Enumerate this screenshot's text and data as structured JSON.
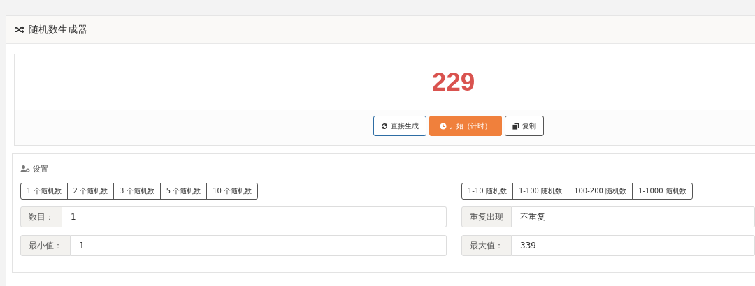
{
  "panel": {
    "title": "随机数生成器"
  },
  "result": {
    "value": "229"
  },
  "actions": [
    {
      "kind": "refresh",
      "label": "直接生成"
    },
    {
      "kind": "clock",
      "label": "开始（计时）",
      "primary": true
    },
    {
      "kind": "copy",
      "label": "复制"
    }
  ],
  "settings": {
    "title": "设置",
    "count_presets": [
      "1 个随机数",
      "2 个随机数",
      "3 个随机数",
      "5 个随机数",
      "10 个随机数"
    ],
    "range_presets": [
      "1-10 随机数",
      "1-100 随机数",
      "100-200 随机数",
      "1-1000 随机数"
    ],
    "fields_left": [
      {
        "label": "数目：",
        "value": "1"
      },
      {
        "label": "最小值：",
        "value": "1"
      }
    ],
    "fields_right": [
      {
        "label": "重复出现",
        "value": "不重复"
      },
      {
        "label": "最大值：",
        "value": "339"
      }
    ]
  }
}
